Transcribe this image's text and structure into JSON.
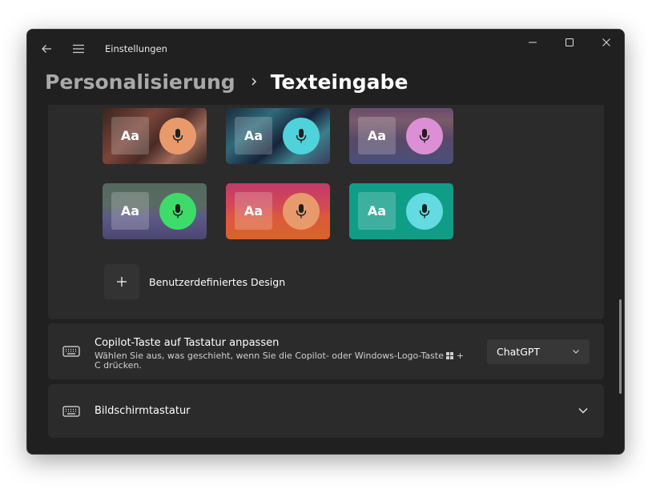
{
  "window": {
    "title": "Einstellungen",
    "controls": {
      "minimize_icon": "minimize-icon",
      "maximize_icon": "maximize-icon",
      "close_icon": "close-icon"
    }
  },
  "breadcrumb": {
    "parent": "Personalisierung",
    "current": "Texteingabe"
  },
  "themes": {
    "tiles": [
      {
        "sample": "Aa",
        "mic_color": "#e89a6c"
      },
      {
        "sample": "Aa",
        "mic_color": "#4fd2d9"
      },
      {
        "sample": "Aa",
        "mic_color": "#dd8fd6"
      },
      {
        "sample": "Aa",
        "mic_color": "#3ddb6a"
      },
      {
        "sample": "Aa",
        "mic_color": "#e89a6c"
      },
      {
        "sample": "Aa",
        "mic_color": "#63dbe0"
      }
    ],
    "add_custom_label": "Benutzerdefiniertes Design"
  },
  "copilot": {
    "title": "Copilot-Taste auf Tastatur anpassen",
    "subtitle_before": "Wählen Sie aus, was geschieht, wenn Sie die Copilot- oder Windows-Logo-Taste",
    "subtitle_after": " + C drücken.",
    "dropdown_value": "ChatGPT"
  },
  "onscreen_keyboard": {
    "title": "Bildschirmtastatur"
  },
  "colors": {
    "window_bg": "#202020",
    "card_bg": "#2b2b2b",
    "accent_text": "#ffffff"
  }
}
